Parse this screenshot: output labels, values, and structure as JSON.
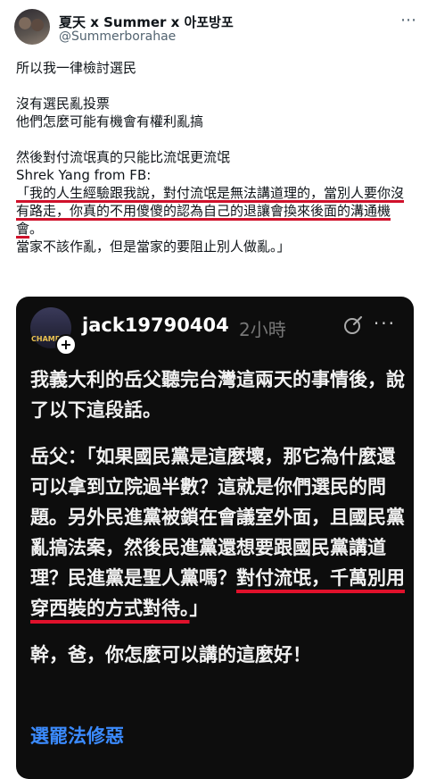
{
  "tweet": {
    "display_name": "夏天 x Summer x 아포방포",
    "handle": "@Summerborahae",
    "more_icon": "more-horizontal-icon",
    "lines": {
      "l1": "所以我一律檢討選民",
      "l2": "沒有選民亂投票",
      "l3": "他們怎麼可能有機會有權利亂搞",
      "l4": "然後對付流氓真的只能比流氓更流氓",
      "l5": "Shrek Yang from FB:",
      "quote_underlined": "「我的人生經驗跟我說，對付流氓是無法講道理的，當別人要你沒有路走，你真的不用傻傻的認為自己的退讓會換來後面的溝通機會",
      "quote_tail": "。",
      "l7": "當家不該作亂，但是當家的要阻止別人做亂。」"
    },
    "underline_color": "#d0112b"
  },
  "embedded_post": {
    "username": "jack19790404",
    "time": "2小時",
    "avatar_text": "CHAMP",
    "plus_label": "+",
    "icons": {
      "action": "edit-circle-icon",
      "more": "more-horizontal-icon"
    },
    "para1": "我義大利的岳父聽完台灣這兩天的事情後，說了以下這段話。",
    "para2_normal": "岳父：「如果國民黨是這麼壞，那它為什麼還可以拿到立院過半數？這就是你們選民的問題。另外民進黨被鎖在會議室外面，且國民黨亂搞法案，然後民進黨還想要跟國民黨講道理？民進黨是聖人黨嗎？",
    "para2_underlined": "對付流氓，千萬別用穿西裝的方式對待。",
    "para2_tail": "」",
    "para3": "幹，爸，你怎麼可以講的這麼好！",
    "link": "選罷法修惡",
    "link_color": "#3b8bff"
  }
}
